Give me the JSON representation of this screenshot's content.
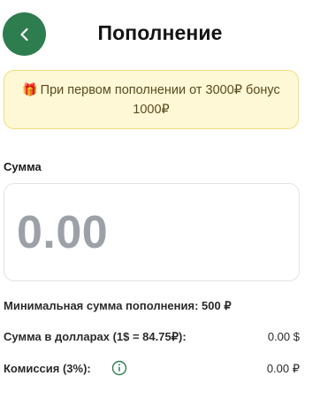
{
  "header": {
    "title": "Пополнение",
    "back_icon": "chevron-left-icon"
  },
  "promo": {
    "icon": "gift-icon",
    "text": "При первом пополнении от 3000₽ бонус 1000₽"
  },
  "amount": {
    "label": "Сумма",
    "placeholder": "0.00",
    "value": ""
  },
  "min_amount": {
    "text": "Минимальная сумма пополнения: 500 ₽"
  },
  "dollars": {
    "label": "Сумма в долларах (1$ = 84.75₽):",
    "value": "0.00 $"
  },
  "commission": {
    "label": "Комиссия (3%):",
    "value": "0.00 ₽",
    "icon": "info-icon"
  },
  "colors": {
    "accent": "#2e7d4f",
    "promo_bg": "#fff8d6",
    "promo_border": "#f2dd7f"
  }
}
